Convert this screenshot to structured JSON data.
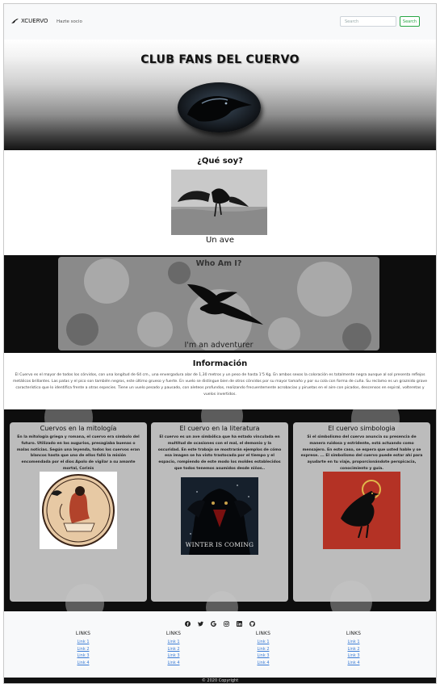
{
  "nav": {
    "brand": "XCUERVO",
    "link": "Hazte socio",
    "search_placeholder": "Search",
    "search_button": "Search"
  },
  "hero": {
    "title": "CLUB FANS DEL CUERVO"
  },
  "quesoy": {
    "title": "¿Qué soy?",
    "caption": "Un ave"
  },
  "whoami": {
    "title": "Who Am I?",
    "caption": "I'm an adventurer"
  },
  "info": {
    "title": "Información",
    "text": "El Cuervo es el mayor de todos los córvidos, con una longitud de 64 cm., una envergadura alar de 1,30 metros y un peso de hasta 1'5 Kg. En ambos sexos la coloración es totalmente negra aunque al sol presenta reflejos metálicos brillantes. Las patas y el pico son también negros, este último grueso y fuerte. En vuelo se distingue bien de otros córvidos por su mayor tamaño y por su cola con forma de cuña. Su reclamo es un graznido grave característico que lo identifica frente a otras especies. Tiene un vuelo pesado y pausado, con aleteos profundos, realizando frecuentemente acrobacias y piruetas en el aire con picados, descensos en espiral, volteretas y vuelos invertidos."
  },
  "cards": [
    {
      "title": "Cuervos en la mitología",
      "text": "En la mitología griega y romana, el cuervo era símbolo del futuro. Utilizado en los augurios, presagiaba buenas o malas noticias. Según una leyenda, todos los cuervos eran blancos hasta que uno de ellos falló la misión encomendada por el dios Apolo de vigilar a su amante mortal, Corinis"
    },
    {
      "title": "El cuervo en la literatura",
      "text": "El cuervo es un ave simbólica que ha estado vinculada en multitud de ocasiones con el mal, el demonio y la oscuridad. En este trabajo se mostrarán ejemplos de cómo esa imagen se ha visto trastocada por el tiempo y el espacio, rompiendo de este modo los moldes establecidos que todos tenemos asumidos desde niños..",
      "image_text": "WINTER IS COMING"
    },
    {
      "title": "El cuervo simbologia",
      "text": "Si el simbolismo del cuervo anuncia su presencia de manera ruidosa y estridente, está actuando como mensajero. En este caso, se espera que usted hable y se exprese. ... El simbolismo del cuervo puede estar ahí para ayudarte en tu viaje, proporcionándote perspicacia, conocimiento y guía."
    }
  ],
  "footer": {
    "social_icons": [
      "facebook-icon",
      "twitter-icon",
      "google-icon",
      "instagram-icon",
      "linkedin-icon",
      "github-icon"
    ],
    "columns": [
      {
        "heading": "LINKS",
        "links": [
          "Link 1",
          "Link 2",
          "Link 3",
          "Link 4"
        ]
      },
      {
        "heading": "LINKS",
        "links": [
          "Link 1",
          "Link 2",
          "Link 3",
          "Link 4"
        ]
      },
      {
        "heading": "LINKS",
        "links": [
          "Link 1",
          "Link 2",
          "Link 3",
          "Link 4"
        ]
      },
      {
        "heading": "LINKS",
        "links": [
          "Link 1",
          "Link 2",
          "Link 3",
          "Link 4"
        ]
      }
    ],
    "copyright": "© 2020 Copyright"
  },
  "colors": {
    "search_green": "#28a745",
    "link_blue": "#3a7bd5",
    "dark": "#111111"
  }
}
